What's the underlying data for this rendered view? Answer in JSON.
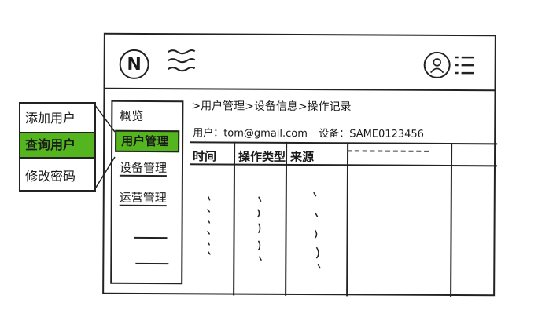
{
  "header": {
    "logo_letter": "N",
    "logo_icon": "n-logo-icon",
    "menu_icon": "hamburger-menu-icon",
    "user_icon": "user-avatar-icon",
    "user_menu_icon": "list-menu-icon"
  },
  "sidebar": {
    "items": [
      {
        "label": "概览"
      },
      {
        "label": "用户管理",
        "active": true
      },
      {
        "label": "设备管理"
      },
      {
        "label": "运营管理"
      }
    ]
  },
  "popup_menu": {
    "items": [
      {
        "label": "添加用户"
      },
      {
        "label": "查询用户",
        "active": true
      },
      {
        "label": "修改密码"
      }
    ]
  },
  "breadcrumb": ">用户管理>设备信息>操作记录",
  "info": {
    "user_label": "用户：",
    "user_value": "tom@gmail.com",
    "device_label": "设备：",
    "device_value": "SAME0123456"
  },
  "table": {
    "headers": [
      "时间",
      "操作类型",
      "来源",
      "",
      ""
    ]
  },
  "colors": {
    "accent_green": "#55b51f"
  }
}
